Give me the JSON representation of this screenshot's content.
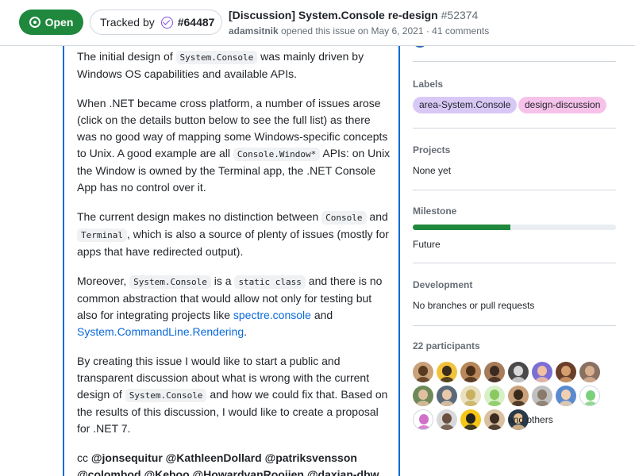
{
  "header": {
    "status": "Open",
    "tracked_label": "Tracked by",
    "tracked_issue": "#64487",
    "title": "[Discussion] System.Console re-design",
    "issue_number": "#52374",
    "author": "adamsitnik",
    "opened_text": "opened this issue on May 6, 2021 · 41 comments"
  },
  "body": {
    "p1": [
      "The initial design of ",
      "System.Console",
      " was mainly driven by Windows OS capabilities and available APIs."
    ],
    "p2": [
      "When .NET became cross platform, a number of issues arose (click on the details button below to see the full list) as there was no good way of mapping some Windows-specific concepts to Unix. A good example are all ",
      "Console.Window*",
      " APIs: on Unix the Window is owned by the Terminal app, the .NET Console App has no control over it."
    ],
    "p3": [
      "The current design makes no distinction between ",
      "Console",
      " and ",
      "Terminal",
      ", which is also a source of plenty of issues (mostly for apps that have redirected output)."
    ],
    "p4": [
      "Moreover, ",
      "System.Console",
      " is a ",
      "static class",
      " and there is no common abstraction that would allow not only for testing but also for integrating projects like ",
      "spectre.console",
      " and ",
      "System.CommandLine.Rendering",
      "."
    ],
    "p5": [
      "By creating this issue I would like to start a public and transparent discussion about what is wrong with the current design of ",
      "System.Console",
      " and how we could fix that. Based on the results of this discussion, I would like to create a proposal for .NET 7."
    ],
    "p6": {
      "prefix": "cc ",
      "mentions": [
        "@jonsequitur",
        "@KathleenDollard",
        "@patriksvensson",
        "@colombod",
        "@Keboo",
        "@HowardvanRooijen",
        "@daxian-dbw"
      ]
    }
  },
  "sidebar": {
    "labels_heading": "Labels",
    "labels": [
      {
        "name": "area-System.Console",
        "color": "#d8c8f5"
      },
      {
        "name": "design-discussion",
        "color": "#f6c2ea"
      }
    ],
    "projects_heading": "Projects",
    "projects_value": "None yet",
    "milestone_heading": "Milestone",
    "milestone_progress": 0.48,
    "milestone_value": "Future",
    "development_heading": "Development",
    "development_value": "No branches or pull requests",
    "participants_heading": "22 participants",
    "participants_more": "and others",
    "participant_avatars": [
      {
        "bg": "#c9a27a",
        "fg": "#5a3b22"
      },
      {
        "bg": "#f2c23b",
        "fg": "#3a2d1a"
      },
      {
        "bg": "#b8875b",
        "fg": "#4b2e1a"
      },
      {
        "bg": "#a67c5a",
        "fg": "#3b2a1f"
      },
      {
        "bg": "#4a4a4a",
        "fg": "#d8d8d8"
      },
      {
        "bg": "#7b6fd6",
        "fg": "#f0c0a0"
      },
      {
        "bg": "#6a3e2a",
        "fg": "#d4a070"
      },
      {
        "bg": "#8a7060",
        "fg": "#d8b090"
      },
      {
        "bg": "#6f8a5a",
        "fg": "#e0c0a0"
      },
      {
        "bg": "#5a6a7a",
        "fg": "#e8c8a8"
      },
      {
        "bg": "#e8e0c0",
        "fg": "#c8b060"
      },
      {
        "bg": "#d8f0c8",
        "fg": "#8ac860"
      },
      {
        "bg": "#c8a07a",
        "fg": "#3a2a1a"
      },
      {
        "bg": "#c0c0c0",
        "fg": "#8a7a6a"
      },
      {
        "bg": "#5a8ad0",
        "fg": "#f0d0b0"
      },
      {
        "bg": "#ffffff",
        "fg": "#7cd07c"
      },
      {
        "bg": "#ffffff",
        "fg": "#d070c8"
      },
      {
        "bg": "#d8d8d8",
        "fg": "#6a5040"
      },
      {
        "bg": "#f5c518",
        "fg": "#222222"
      },
      {
        "bg": "#d8c0a0",
        "fg": "#3a2a20"
      },
      {
        "bg": "#2a3a4a",
        "fg": "#e8c090"
      }
    ]
  }
}
